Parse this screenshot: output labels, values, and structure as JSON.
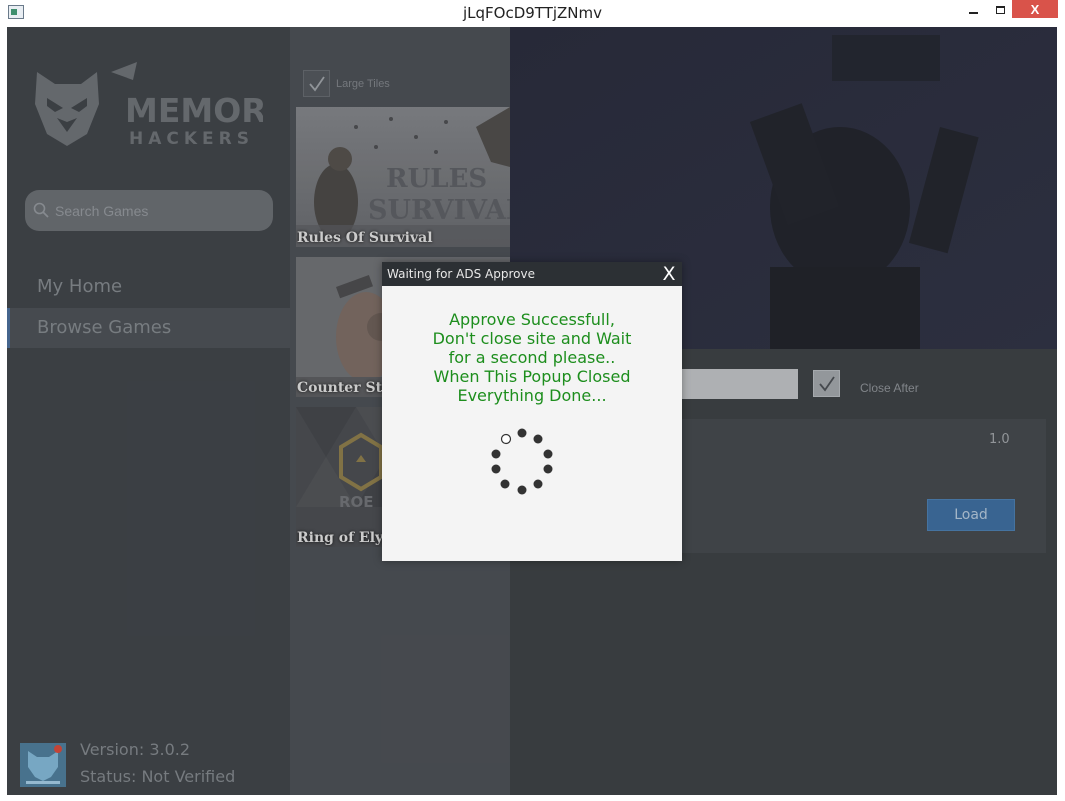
{
  "window": {
    "title": "jLqFOcD9TTjZNmv",
    "minimize_icon": "minimize-icon",
    "maximize_icon": "maximize-icon",
    "close_label": "X"
  },
  "sidebar": {
    "logo_text_line1": "MEMORY",
    "logo_text_line2": "HACKERS",
    "search_placeholder": "Search Games",
    "nav": [
      {
        "label": "My Home",
        "active": false
      },
      {
        "label": "Browse Games",
        "active": true
      }
    ],
    "version": "Version: 3.0.2",
    "status": "Status: Not Verified"
  },
  "games": {
    "large_tiles_label": "Large Tiles",
    "large_tiles_checked": true,
    "tiles": [
      {
        "label": "Rules Of Survival",
        "art_text_1": "RULES",
        "art_text_2": "SURVIVAL"
      },
      {
        "label": "Counter Stri"
      },
      {
        "label": "Ring of Elysi",
        "art_text": "ROE"
      }
    ]
  },
  "main": {
    "close_after_label": "Close After",
    "close_after_checked": true,
    "version_value": "1.0",
    "load_label": "Load"
  },
  "popup": {
    "title": "Waiting for ADS Approve",
    "close_label": "X",
    "message_lines": [
      "Approve Successfull,",
      "Don't close site and Wait",
      "for a second please..",
      "When This Popup Closed",
      "Everything Done..."
    ]
  },
  "colors": {
    "sidebar_bg": "#2f3338",
    "accent_blue": "#2d5b8b",
    "popup_text_green": "#1d8e1d",
    "titlebar_close_red": "#d9534a"
  }
}
